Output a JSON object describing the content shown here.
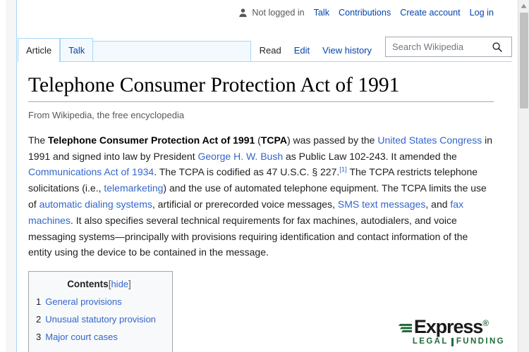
{
  "personal_bar": {
    "user_icon": "user-icon",
    "not_logged_in": "Not logged in",
    "talk": "Talk",
    "contributions": "Contributions",
    "create_account": "Create account",
    "log_in": "Log in"
  },
  "namespace_tabs": [
    {
      "label": "Article",
      "state": "selected"
    },
    {
      "label": "Talk",
      "state": "inactive"
    }
  ],
  "view_tabs": [
    {
      "label": "Read",
      "state": "selected"
    },
    {
      "label": "Edit",
      "state": "inactive"
    },
    {
      "label": "View history",
      "state": "inactive"
    }
  ],
  "search": {
    "placeholder": "Search Wikipedia",
    "value": "",
    "icon": "search-icon"
  },
  "article": {
    "title": "Telephone Consumer Protection Act of 1991",
    "site_sub": "From Wikipedia, the free encyclopedia",
    "paragraph": {
      "s1": "The ",
      "bold_term": "Telephone Consumer Protection Act of 1991",
      "s2": " (",
      "bold_abbr": "TCPA",
      "s3": ") was passed by the ",
      "link_congress": "United States Congress",
      "s4": " in 1991 and signed into law by President ",
      "link_bush": "George H. W. Bush",
      "s5": " as Public Law 102-243. It amended the ",
      "link_comm_act": "Communications Act of 1934",
      "s6": ". The TCPA is codified as 47 U.S.C. § 227.",
      "ref1": "[1]",
      "s7": " The TCPA restricts telephone solicitations (i.e., ",
      "link_telemarketing": "telemarketing",
      "s8": ") and the use of automated telephone equipment. The TCPA limits the use of ",
      "link_autodial": "automatic dialing systems",
      "s9": ", artificial or prerecorded voice messages, ",
      "link_sms": "SMS text messages",
      "s10": ", and ",
      "link_fax": "fax machines",
      "s11": ". It also specifies several technical requirements for fax machines, autodialers, and voice messaging systems—principally with provisions requiring identification and contact information of the entity using the device to be contained in the message."
    }
  },
  "toc": {
    "heading": "Contents",
    "bracket_open": "[",
    "toggle": "hide",
    "bracket_close": "]",
    "items": [
      {
        "number": "1",
        "label": "General provisions"
      },
      {
        "number": "2",
        "label": "Unusual statutory provision"
      },
      {
        "number": "3",
        "label": "Major court cases"
      }
    ]
  },
  "brand": {
    "word": "Express",
    "tm": "®",
    "sub_left": "LEGAL",
    "sub_right": "FUNDING",
    "color_green": "#1f6b3b",
    "color_black": "#1a1a1a"
  },
  "scrollbar": {
    "up_arrow": "scroll-up-arrow-icon"
  },
  "colors": {
    "link_blue": "#3366cc",
    "personal_link_blue": "#0645ad",
    "tab_border": "#a7d7f9",
    "text": "#202122"
  }
}
